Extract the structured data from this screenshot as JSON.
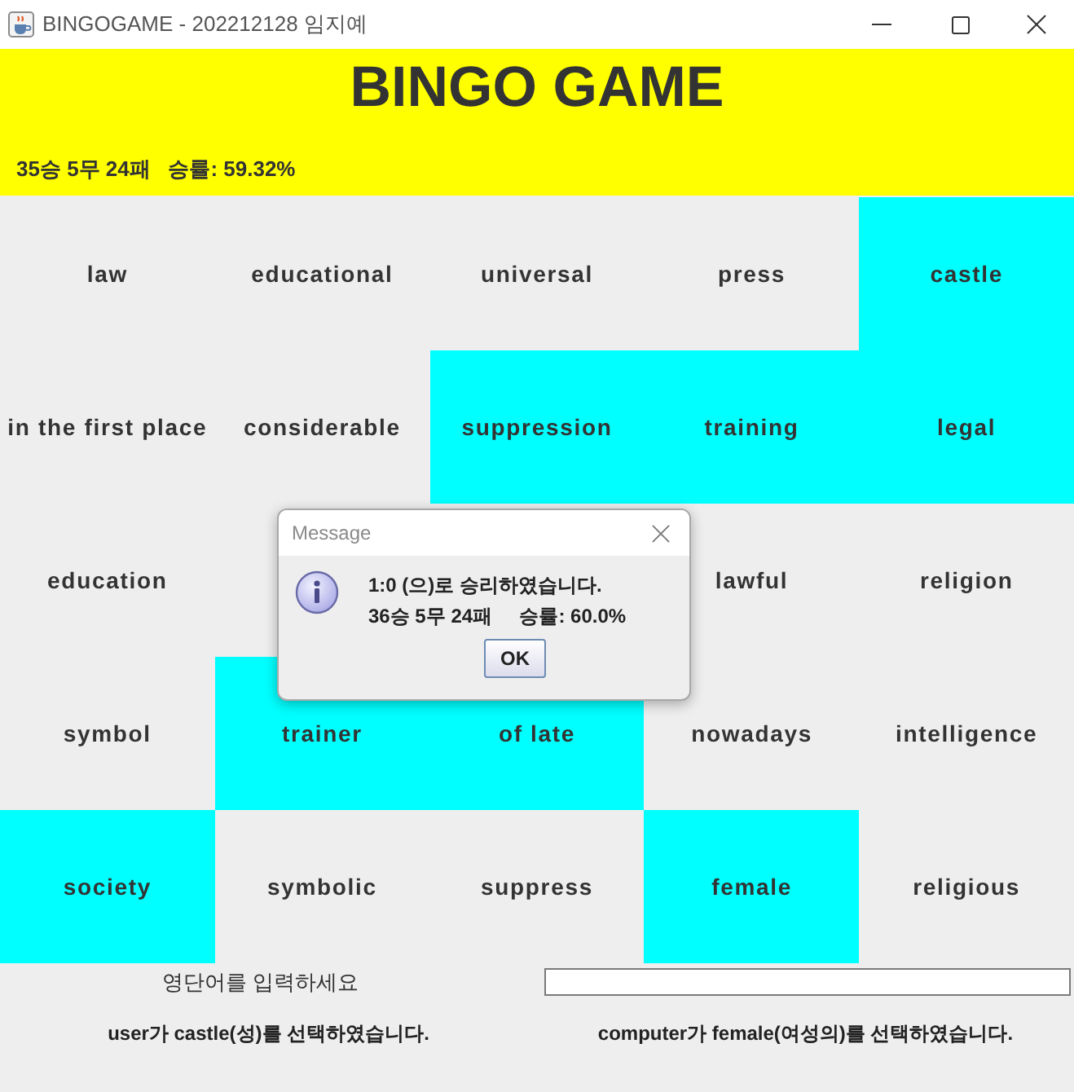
{
  "window": {
    "title": "BINGOGAME - 202212128 임지예"
  },
  "header": {
    "title": "BINGO GAME",
    "record": "35승 5무 24패   승률: 59.32%"
  },
  "board": {
    "rows": [
      [
        {
          "word": "law",
          "marked": false
        },
        {
          "word": "educational",
          "marked": false
        },
        {
          "word": "universal",
          "marked": false
        },
        {
          "word": "press",
          "marked": false
        },
        {
          "word": "castle",
          "marked": true
        }
      ],
      [
        {
          "word": "in the first place",
          "marked": false
        },
        {
          "word": "considerable",
          "marked": false
        },
        {
          "word": "suppression",
          "marked": true
        },
        {
          "word": "training",
          "marked": true
        },
        {
          "word": "legal",
          "marked": true
        }
      ],
      [
        {
          "word": "education",
          "marked": false
        },
        null,
        null,
        {
          "word": "lawful",
          "marked": false
        },
        {
          "word": "religion",
          "marked": false
        }
      ],
      [
        {
          "word": "symbol",
          "marked": false
        },
        {
          "word": "trainer",
          "marked": true
        },
        {
          "word": "of late",
          "marked": true
        },
        {
          "word": "nowadays",
          "marked": false
        },
        {
          "word": "intelligence",
          "marked": false
        }
      ],
      [
        {
          "word": "society",
          "marked": true
        },
        {
          "word": "symbolic",
          "marked": false
        },
        {
          "word": "suppress",
          "marked": false
        },
        {
          "word": "female",
          "marked": true
        },
        {
          "word": "religious",
          "marked": false
        }
      ]
    ]
  },
  "input": {
    "label": "영단어를 입력하세요"
  },
  "status": {
    "user_move": "user가 castle(성)를 선택하였습니다.",
    "computer_move": "computer가 female(여성의)를 선택하였습니다."
  },
  "dialog": {
    "title": "Message",
    "lines": [
      "1:0 (으)로 승리하였습니다.",
      "36승 5무 24패     승률: 60.0%"
    ],
    "button": "OK"
  }
}
